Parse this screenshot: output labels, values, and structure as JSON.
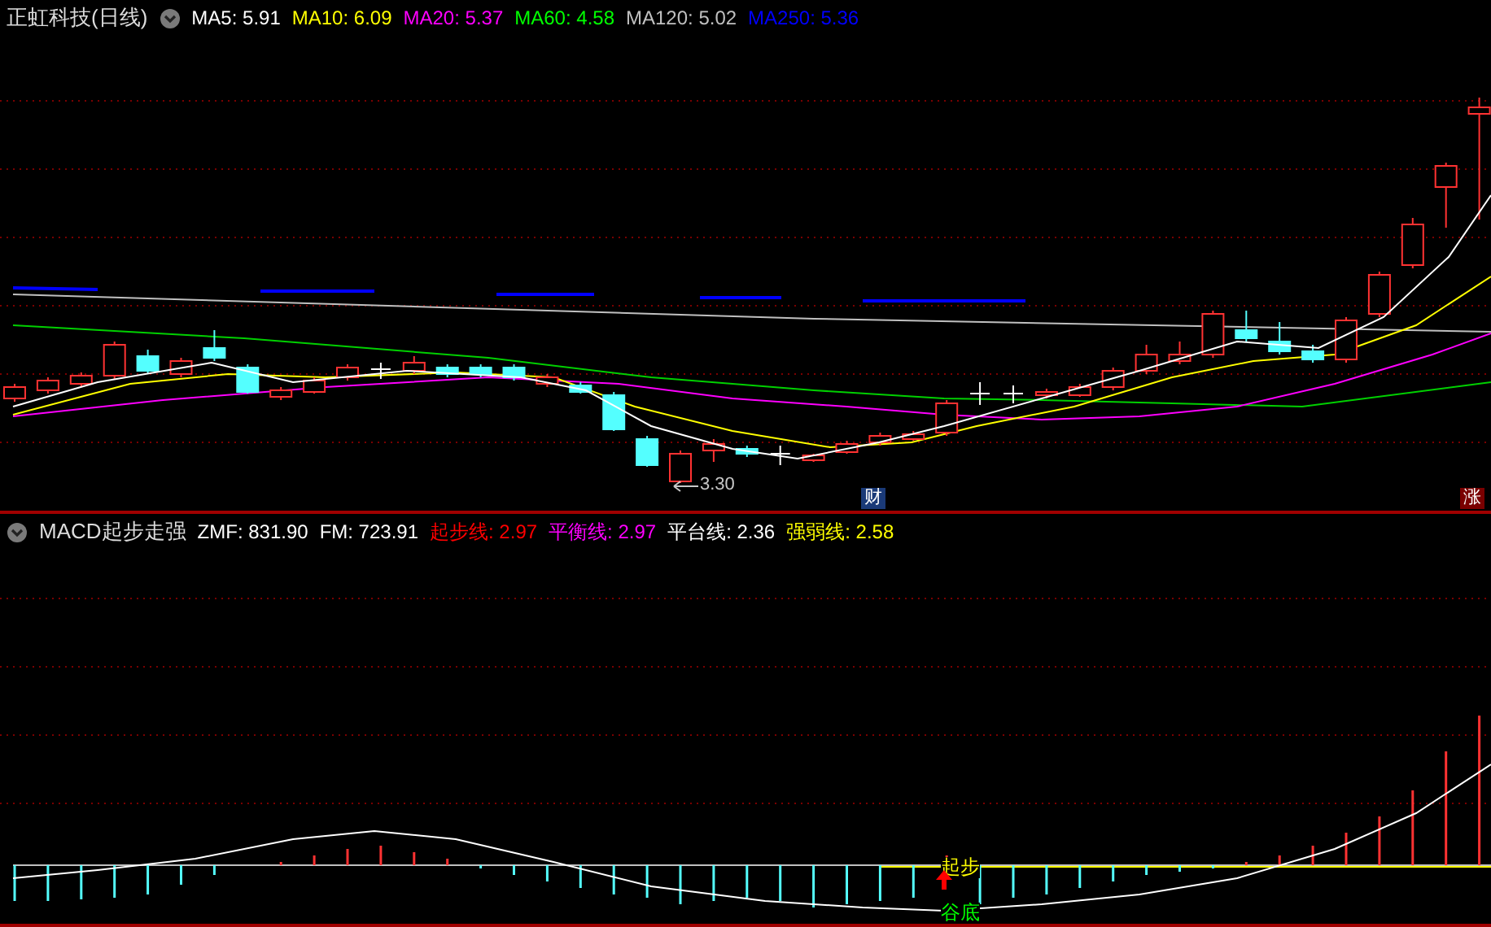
{
  "price_panel": {
    "title": "正虹科技(日线)",
    "indicators": [
      {
        "label": "MA5: 5.91",
        "color": "#ffffff"
      },
      {
        "label": "MA10: 6.09",
        "color": "#ffff00"
      },
      {
        "label": "MA20: 5.37",
        "color": "#ff00ff"
      },
      {
        "label": "MA60: 4.58",
        "color": "#00ff00"
      },
      {
        "label": "MA120: 5.02",
        "color": "#c0c0c0"
      },
      {
        "label": "MA250: 5.36",
        "color": "#0000ff"
      }
    ],
    "low_label": "3.30",
    "badges": [
      {
        "text": "财",
        "color": "#1a3a78"
      },
      {
        "text": "涨",
        "color": "#7a0000"
      }
    ]
  },
  "macd_panel": {
    "title": "MACD起步走强",
    "values": [
      {
        "label": "ZMF: 831.90",
        "color": "#ffffff"
      },
      {
        "label": "FM: 723.91",
        "color": "#ffffff"
      },
      {
        "label": "起步线: 2.97",
        "color": "#ff0000"
      },
      {
        "label": "平衡线: 2.97",
        "color": "#ff00ff"
      },
      {
        "label": "平台线: 2.36",
        "color": "#ffffff"
      },
      {
        "label": "强弱线: 2.58",
        "color": "#ffff00"
      }
    ],
    "signals": [
      {
        "text": "起步",
        "kind": "start"
      },
      {
        "text": "谷底",
        "kind": "bottom"
      }
    ]
  }
}
